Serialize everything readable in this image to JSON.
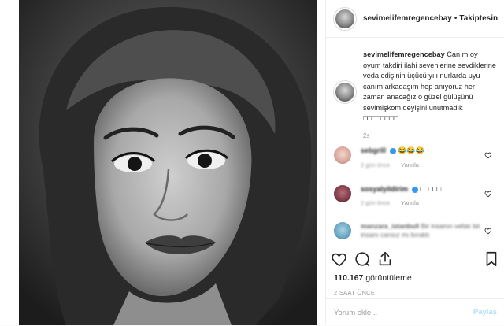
{
  "post": {
    "photo_alt": "",
    "header": {
      "username": "sevimelifemregencebay",
      "separator": "•",
      "follow_label": "Takiptesin"
    },
    "caption": {
      "username": "sevimelifemregencebay",
      "text": "Canım oy oyum takdiri ilahi sevenlerine sevdiklerine veda edişinin üçücü yılı nurlarda uyu canım arkadaşım hep anıyoruz her zaman anacağız o güzel gülüşünü sevimişkom deyişini unutmadık □□□□□□□□",
      "time": "2s"
    },
    "comments": [
      {
        "user": "sebgrill",
        "text": "😂😂😂",
        "time": "2 gün önce",
        "reply": "Yanıtla",
        "verified": true
      },
      {
        "user": "sosyalyildirim",
        "text": "□□□□□",
        "time": "2 gün önce",
        "reply": "Yanıtla",
        "verified": true
      },
      {
        "user": "manzara_istanbull",
        "text": "Bir insanın vefatı bir insanı cansız mı bıraktı",
        "time": "",
        "reply": "",
        "verified": false
      }
    ],
    "stats": {
      "views_count": "110.167",
      "views_label": "görüntüleme",
      "posted": "2 SAAT ÖNCE"
    },
    "add_comment": {
      "placeholder": "Yorum ekle...",
      "share_label": "Paylaş"
    },
    "icons": [
      "heart-icon",
      "comment-icon",
      "share-icon",
      "bookmark-icon"
    ]
  }
}
